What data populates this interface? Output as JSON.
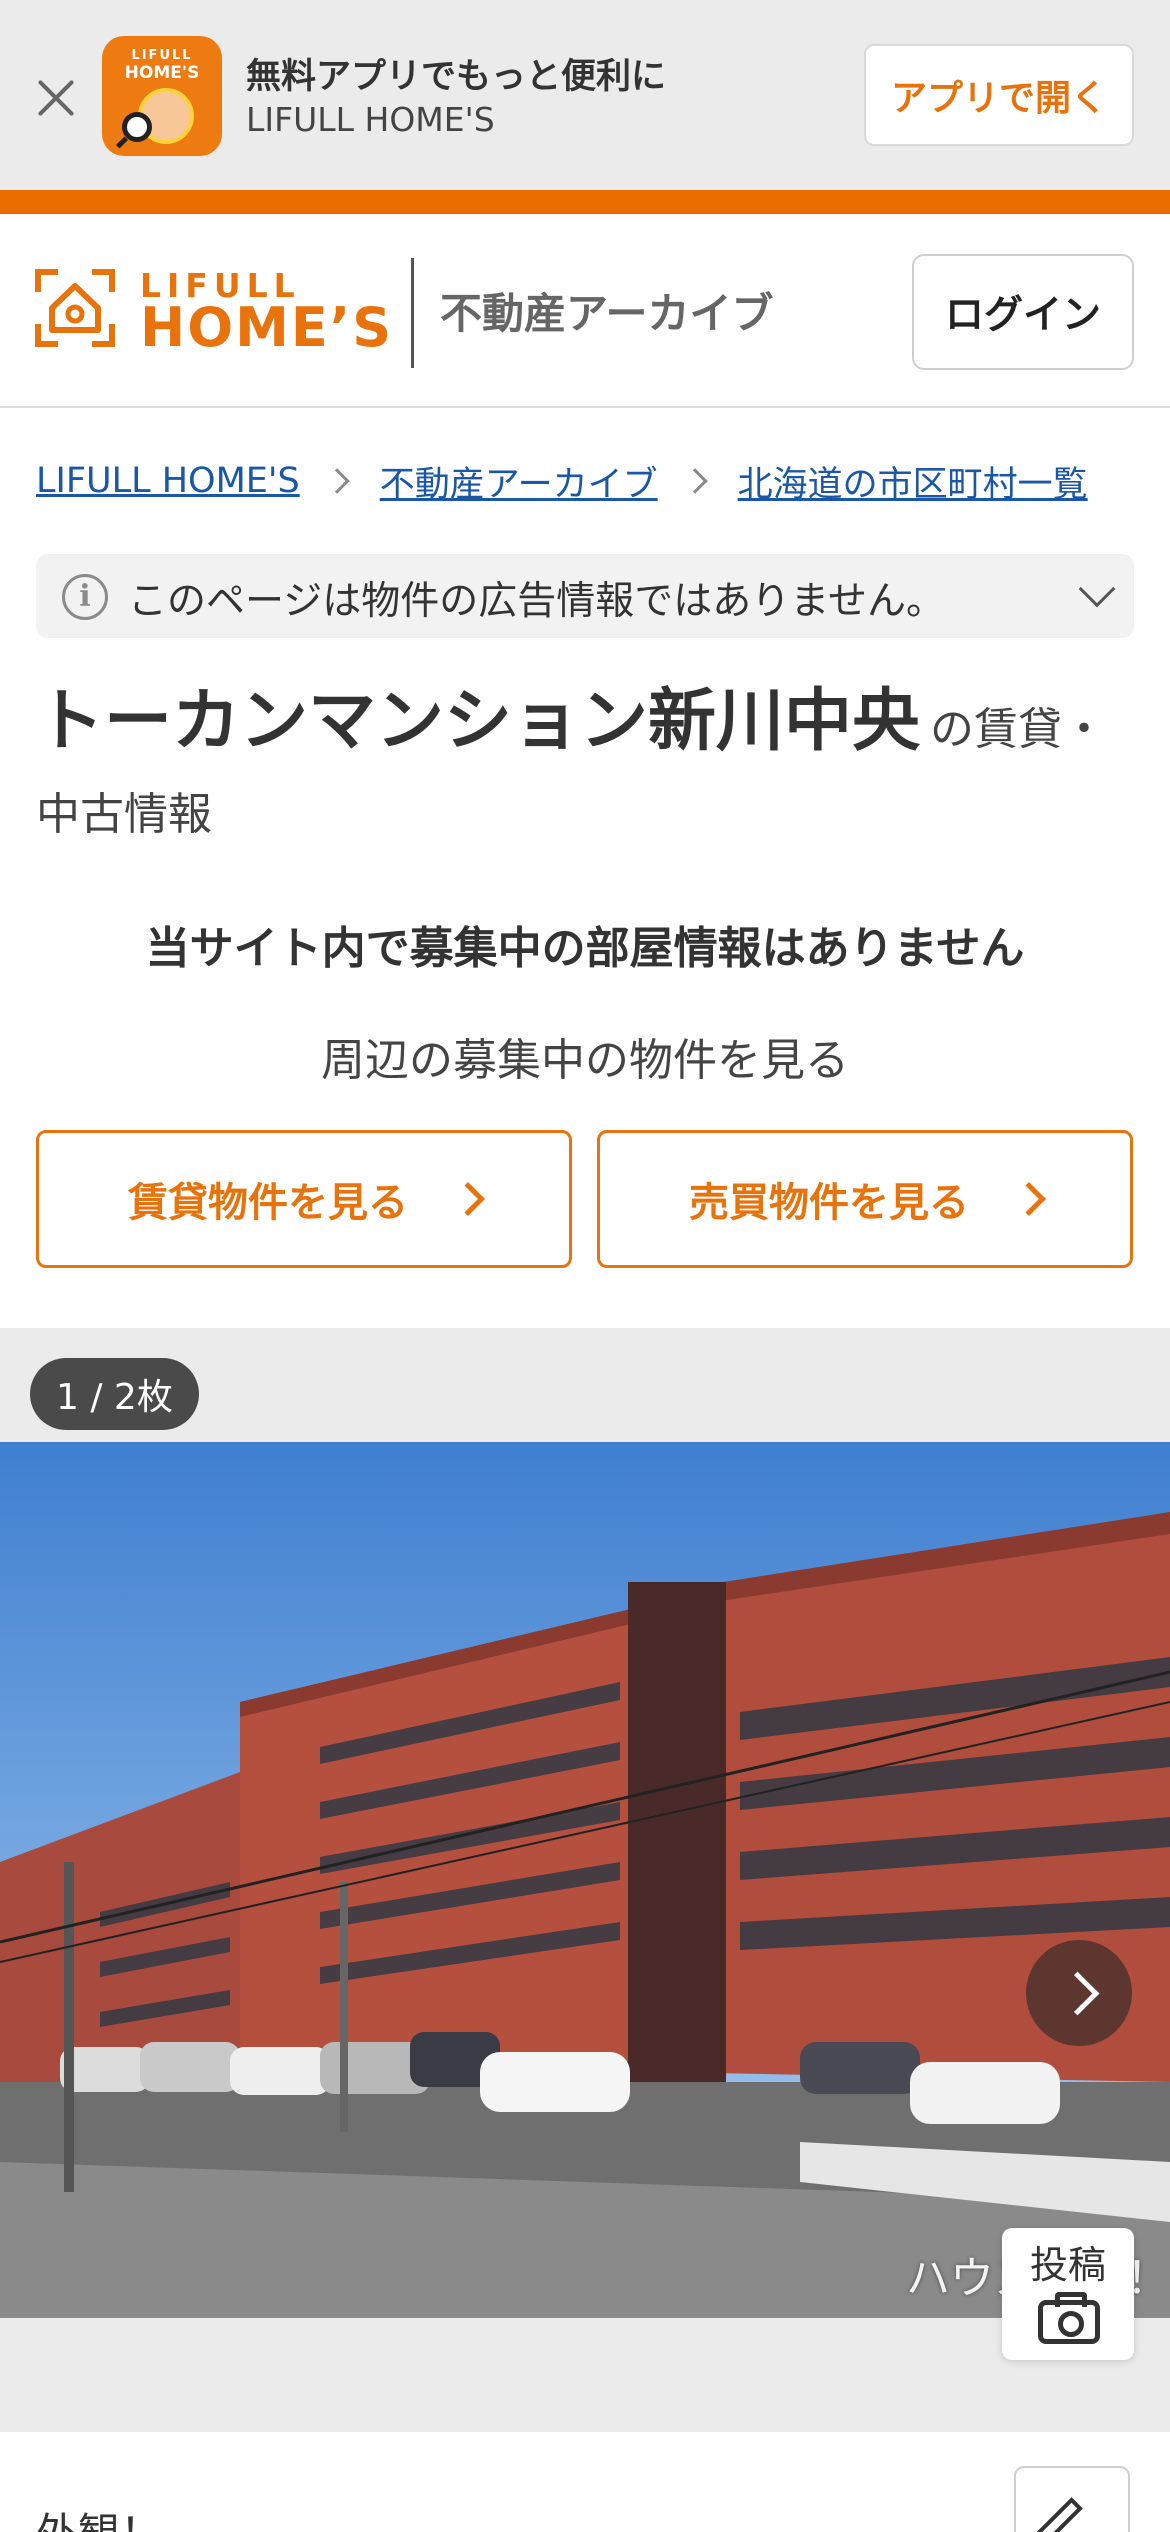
{
  "app_banner": {
    "title": "無料アプリでもっと便利に",
    "subtitle": "LIFULL HOME'S",
    "open_label": "アプリで開く",
    "icon_line1": "LIFULL",
    "icon_line2": "HOME'S"
  },
  "header": {
    "logo_line1": "LIFULL",
    "logo_line2": "HOME’S",
    "section": "不動産アーカイブ",
    "login_label": "ログイン"
  },
  "breadcrumb": [
    {
      "label": "LIFULL HOME'S"
    },
    {
      "label": "不動産アーカイブ"
    },
    {
      "label": "北海道の市区町村一覧"
    }
  ],
  "notice": {
    "text": "このページは物件の広告情報ではありません。"
  },
  "property": {
    "name": "トーカンマンション新川中央",
    "suffix": "の賃貸・中古情報",
    "no_rooms": "当サイト内で募集中の部屋情報はありません",
    "nearby": "周辺の募集中の物件を見る",
    "rent_button": "賃貸物件を見る",
    "buy_button": "売買物件を見る"
  },
  "gallery": {
    "counter": "1 / 2枚",
    "watermark": "ハウスドゥ！",
    "post_label": "投稿"
  },
  "section_label": "外観！",
  "colors": {
    "accent": "#e8730c",
    "link": "#1a57a6",
    "banner_bg": "#ebebeb"
  }
}
